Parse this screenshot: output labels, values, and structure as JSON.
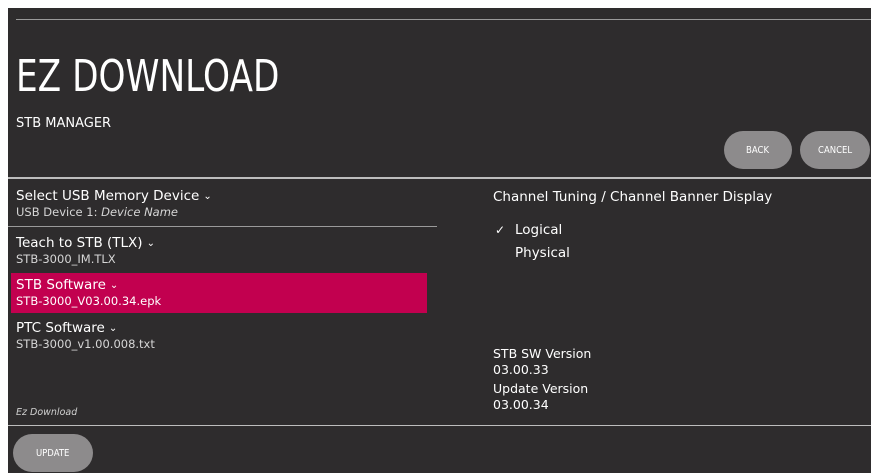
{
  "header": {
    "title": "EZ DOWNLOAD",
    "subtitle": "STB MANAGER"
  },
  "buttons": {
    "back": "BACK",
    "cancel": "CANCEL",
    "update": "UPDATE"
  },
  "menu": {
    "items": [
      {
        "label": "Select USB Memory Device",
        "value_prefix": "USB Device 1: ",
        "value_italic": "Device Name"
      },
      {
        "label": "Teach to STB (TLX)",
        "value": "STB-3000_IM.TLX"
      },
      {
        "label": "STB Software",
        "value": "STB-3000_V03.00.34.epk",
        "selected": true
      },
      {
        "label": "PTC Software",
        "value": "STB-3000_v1.00.008.txt"
      }
    ],
    "footnote": "Ez Download"
  },
  "channel": {
    "title": "Channel Tuning / Channel Banner Display",
    "options": [
      {
        "label": "Logical",
        "checked": true
      },
      {
        "label": "Physical",
        "checked": false
      }
    ]
  },
  "version": {
    "sw_label": "STB SW Version",
    "sw_value": "03.00.33",
    "update_label": "Update Version",
    "update_value": "03.00.34"
  },
  "colors": {
    "background": "#2e2c2d",
    "selected_highlight": "#c2004f",
    "button": "#8d8b8c"
  },
  "icons": {
    "dropdown": "chevron-down-icon",
    "check": "checkmark-icon"
  }
}
